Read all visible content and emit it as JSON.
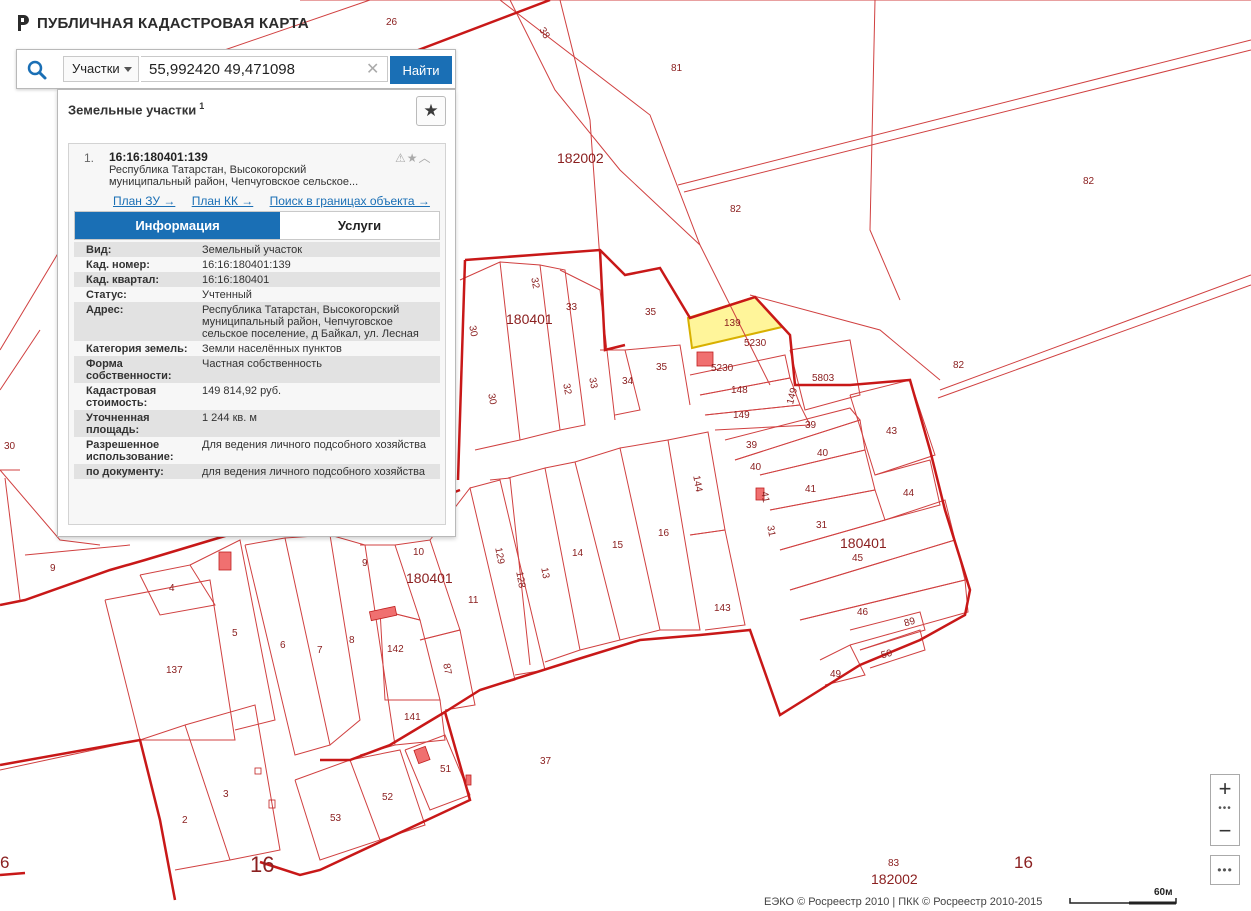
{
  "header": {
    "title": "ПУБЛИЧНАЯ КАДАСТРОВАЯ КАРТА"
  },
  "search": {
    "type_label": "Участки",
    "query": "55,992420 49,471098",
    "clear_icon": "✕",
    "find_label": "Найти"
  },
  "panel": {
    "title": "Земельные участки",
    "count": "1",
    "result": {
      "index": "1.",
      "number": "16:16:180401:139",
      "address_short": "Республика Татарстан, Высокогорский муниципальный район, Чепчуговское сельское...",
      "links": [
        "План ЗУ →",
        "План КК →",
        "Поиск в границах объекта →"
      ],
      "tabs": [
        "Информация",
        "Услуги"
      ],
      "rows": [
        {
          "key": "Вид:",
          "value": "Земельный участок"
        },
        {
          "key": "Кад. номер:",
          "value": "16:16:180401:139"
        },
        {
          "key": "Кад. квартал:",
          "value": "16:16:180401"
        },
        {
          "key": "Статус:",
          "value": "Учтенный"
        },
        {
          "key": "Адрес:",
          "value": "Республика Татарстан, Высокогорский муниципальный район, Чепчуговское сельское поселение, д Байкал, ул. Лесная"
        },
        {
          "key": "Категория земель:",
          "value": "Земли населённых пунктов"
        },
        {
          "key": "Форма собственности:",
          "value": "Частная собственность"
        },
        {
          "key": "Кадастровая стоимость:",
          "value": "149 814,92 руб."
        },
        {
          "key": "Уточненная площадь:",
          "value": "1 244 кв. м"
        },
        {
          "key": "Разрешенное использование:",
          "value": "Для ведения личного подсобного хозяйства"
        },
        {
          "key": "по документу:",
          "value": "для ведения личного подсобного хозяйства"
        }
      ]
    }
  },
  "map": {
    "highlight_color": "#fff59a",
    "boundary_color": "#c81818",
    "labels": {
      "l26": "26",
      "l38": "38",
      "l81": "81",
      "l182002a": "182002",
      "l82a": "82",
      "l82b": "82",
      "l82c": "82",
      "l139": "139",
      "l5230a": "5230",
      "l5230b": "5230",
      "l148": "148",
      "l149a": "149",
      "l149b": "149",
      "l5803": "5803",
      "l35a": "35",
      "l35b": "35",
      "l33a": "33",
      "l33b": "33",
      "l32a": "32",
      "l32b": "32",
      "l34": "34",
      "l30a": "30",
      "l30b": "30",
      "l30c": "30",
      "l180401a": "180401",
      "l180401b": "180401",
      "l180401c": "180401",
      "l39a": "39",
      "l39b": "39",
      "l40a": "40",
      "l40b": "40",
      "l41a": "41",
      "l41b": "41",
      "l43": "43",
      "l44": "44",
      "l31a": "31",
      "l31b": "31",
      "l45": "45",
      "l46": "46",
      "l89": "89",
      "l50": "50",
      "l49": "49",
      "l144": "144",
      "l143": "143",
      "l16a": "16",
      "l15": "15",
      "l14": "14",
      "l13": "13",
      "l128": "128",
      "l129": "129",
      "l11": "11",
      "l10": "10",
      "l9a": "9",
      "l9b": "9",
      "l4": "4",
      "l5": "5",
      "l6": "6",
      "l7": "7",
      "l8": "8",
      "l137": "137",
      "l142": "142",
      "l87": "87",
      "l141": "141",
      "l51": "51",
      "l37": "37",
      "l2": "2",
      "l3": "3",
      "l53": "53",
      "l52": "52",
      "l16big": "16",
      "l16right": "16",
      "l6left": "6",
      "l83": "83",
      "l182002b": "182002"
    }
  },
  "controls": {
    "zoom_in": "+",
    "zoom_out": "−",
    "dots": "•••",
    "more": "•••"
  },
  "footer": {
    "attribution": "ЕЭКО © Росреестр 2010 | ПКК © Росреестр 2010-2015",
    "scale_label": "60м"
  }
}
